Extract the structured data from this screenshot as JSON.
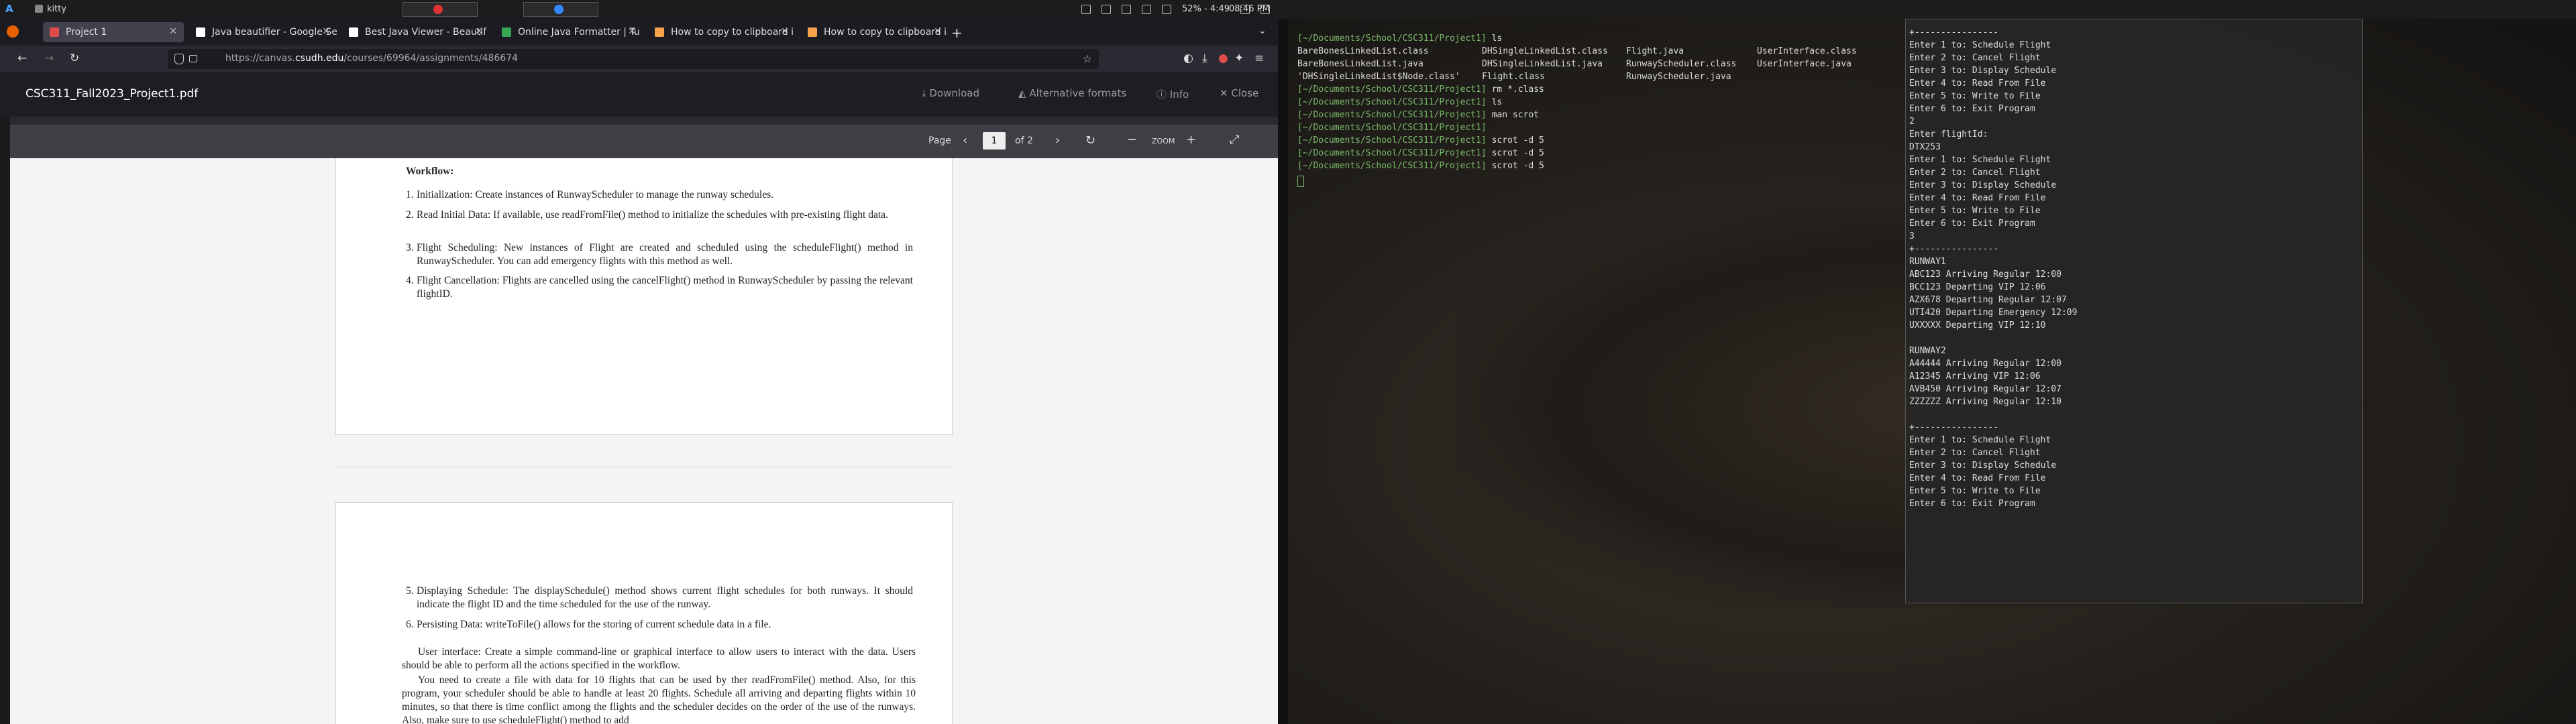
{
  "panel": {
    "app_label": "A",
    "window_title": "kitty",
    "tray_status": "52% - 4:49",
    "clock": "08:46 PM"
  },
  "browser": {
    "tabs": [
      {
        "title": "Project 1",
        "favicon_color": "#e04b4b",
        "active": true
      },
      {
        "title": "Java beautifier - Google Se",
        "favicon_color": "#ffffff"
      },
      {
        "title": "Best Java Viewer - Beautif",
        "favicon_color": "#ffffff"
      },
      {
        "title": "Online Java Formatter | Tu",
        "favicon_color": "#35a853"
      },
      {
        "title": "How to copy to clipboard i",
        "favicon_color": "#f4a24b"
      },
      {
        "title": "How to copy to clipboard i",
        "favicon_color": "#f4a24b"
      }
    ],
    "url_prefix": "https://canvas.",
    "url_domain": "csudh.edu",
    "url_path": "/courses/69964/assignments/486674"
  },
  "pdf": {
    "filename": "CSC311_Fall2023_Project1.pdf",
    "download": "Download",
    "alt_formats": "Alternative formats",
    "info": "Info",
    "close": "Close",
    "page_label": "Page",
    "page_current": "1",
    "page_total": "of 2",
    "zoom_label": "ZOOM"
  },
  "doc": {
    "workflow_heading": "Workflow:",
    "workflow": [
      "Initialization: Create instances of RunwayScheduler to manage the runway schedules.",
      "Read Initial Data: If available, use readFromFile() method to initialize the schedules with pre-existing flight data.",
      "Flight Scheduling: New instances of Flight are created and scheduled using the scheduleFlight() method in RunwayScheduler. You can add emergency flights with this method as well.",
      "Flight Cancellation: Flights are cancelled using the cancelFlight() method in RunwayScheduler by passing the relevant flightID."
    ],
    "page2_items": [
      "Displaying Schedule: The displaySchedule() method shows current flight schedules for both runways. It should indicate the flight ID and the time scheduled for the use of the runway.",
      "Persisting Data: writeToFile() allows for the storing of current schedule data in a file."
    ],
    "ui_para": "User interface: Create a simple command-line or graphical interface to allow users to interact with the data. Users should be able to perform all the actions specified in the workflow.",
    "need_para": "You need to create a file with data for 10 flights that can be used by ther readFromFile() method. Also, for this program, your scheduler should be able to handle at least 20 flights. Schedule all arriving and departing flights within 10 minutes, so that there is time conflict among the flights and the scheduler decides on the order of the use of the runways. Also, make sure to use scheduleFlight() method to add"
  },
  "terminal": {
    "prompt": "[~/Documents/School/CSC311/Project1]",
    "history": [
      {
        "cmd": "ls"
      },
      {
        "cmd": "rm *.class"
      },
      {
        "cmd": "ls"
      },
      {
        "cmd": "man scrot"
      },
      {
        "cmd": ""
      },
      {
        "cmd": "scrot -d 5"
      },
      {
        "cmd": "scrot -d 5"
      },
      {
        "cmd": "scrot -d 5"
      }
    ],
    "ls_output": [
      [
        "BareBonesLinkedList.class",
        "DHSingleLinkedList.class",
        "Flight.java",
        "UserInterface.class"
      ],
      [
        "BareBonesLinkedList.java",
        "DHSingleLinkedList.java",
        "RunwayScheduler.class",
        "UserInterface.java"
      ],
      [
        "'DHSingleLinkedList$Node.class'",
        "Flight.class",
        "RunwayScheduler.java",
        ""
      ]
    ],
    "right_lines": [
      "+----------------",
      "Enter 1 to: Schedule Flight",
      "Enter 2 to: Cancel Flight",
      "Enter 3 to: Display Schedule",
      "Enter 4 to: Read From File",
      "Enter 5 to: Write to File",
      "Enter 6 to: Exit Program",
      "2",
      "Enter flightId:",
      "DTX253",
      "Enter 1 to: Schedule Flight",
      "Enter 2 to: Cancel Flight",
      "Enter 3 to: Display Schedule",
      "Enter 4 to: Read From File",
      "Enter 5 to: Write to File",
      "Enter 6 to: Exit Program",
      "3",
      "+----------------",
      "RUNWAY1",
      "ABC123 Arriving Regular 12:00",
      "BCC123 Departing VIP 12:06",
      "AZX678 Departing Regular 12:07",
      "UTI420 Departing Emergency 12:09",
      "UXXXXX Departing VIP 12:10",
      "",
      "RUNWAY2",
      "A44444 Arriving Regular 12:00",
      "A12345 Arriving VIP 12:06",
      "AVB450 Arriving Regular 12:07",
      "ZZZZZZ Arriving Regular 12:10",
      "",
      "+----------------",
      "Enter 1 to: Schedule Flight",
      "Enter 2 to: Cancel Flight",
      "Enter 3 to: Display Schedule",
      "Enter 4 to: Read From File",
      "Enter 5 to: Write to File",
      "Enter 6 to: Exit Program"
    ]
  }
}
